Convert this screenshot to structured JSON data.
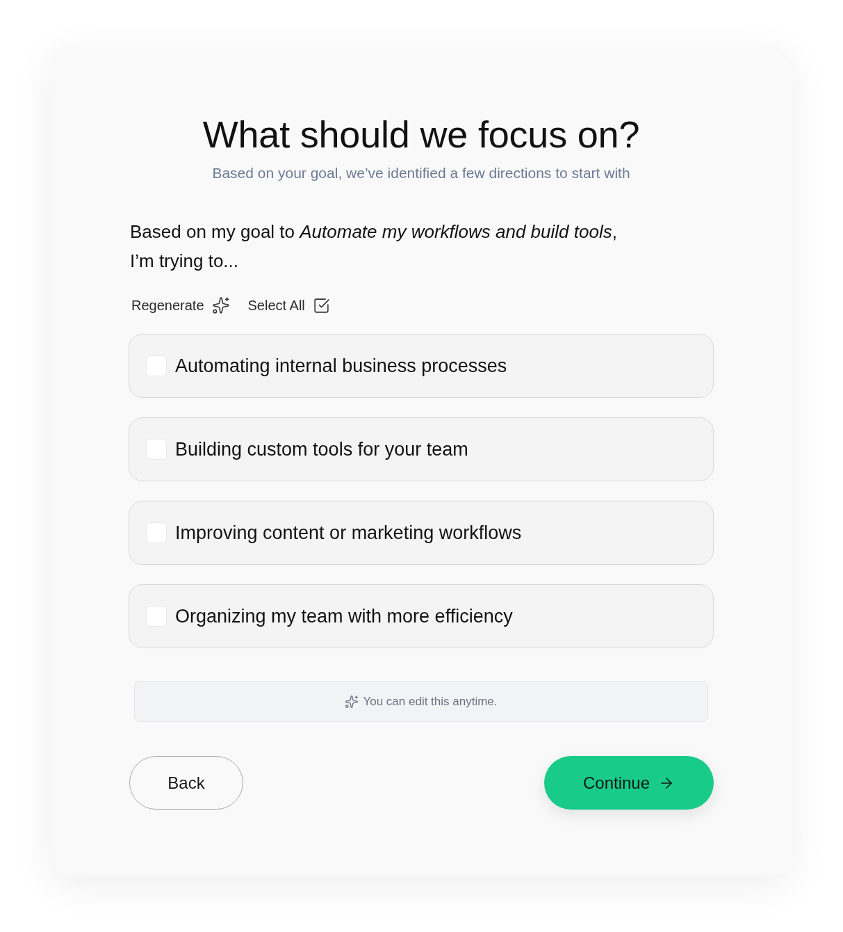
{
  "heading": {
    "title": "What should we focus on?",
    "subtitle": "Based on your goal, we’ve identified a few directions to start with"
  },
  "prompt": "Based on my goal to *Automate my workflows and build tools*, I’m trying to...",
  "actions": [
    {
      "label": "Regenerate",
      "kind": "regenerate"
    },
    {
      "label": "Select All",
      "kind": "select_all"
    }
  ],
  "options": [
    {
      "label": "Automating internal business processes",
      "checked": false
    },
    {
      "label": "Building custom tools for your team",
      "checked": false
    },
    {
      "label": "Improving content or marketing workflows",
      "checked": false
    },
    {
      "label": "Organizing my team with more efficiency",
      "checked": false
    }
  ],
  "note": {
    "text": "You can edit this anytime."
  },
  "buttons": [
    {
      "label": "Back",
      "kind": "secondary"
    },
    {
      "label": "Continue",
      "kind": "primary"
    }
  ]
}
